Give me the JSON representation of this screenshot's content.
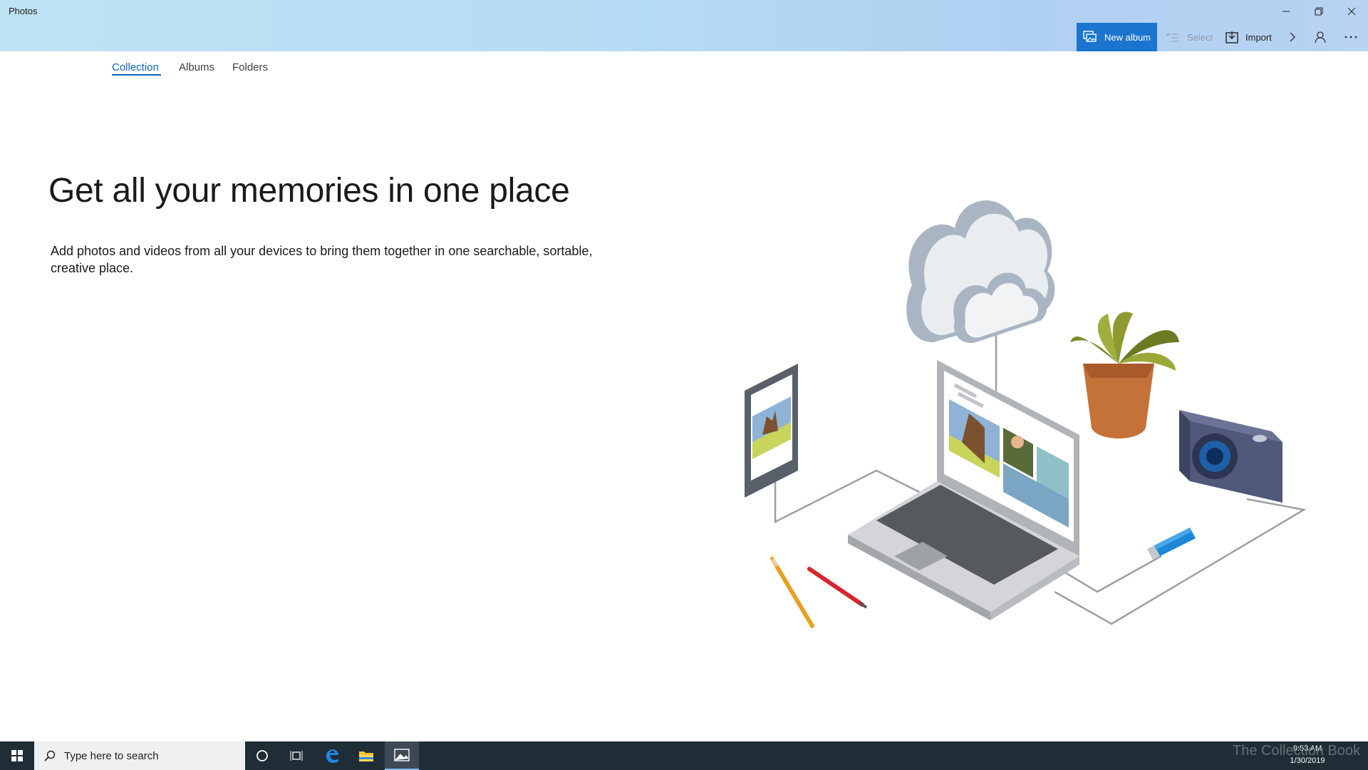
{
  "window": {
    "title": "Photos"
  },
  "commandbar": {
    "new_album_label": "New album",
    "select_label": "Select",
    "import_label": "Import"
  },
  "tabs": [
    {
      "label": "Collection",
      "active": true
    },
    {
      "label": "Albums",
      "active": false
    },
    {
      "label": "Folders",
      "active": false
    }
  ],
  "hero": {
    "headline": "Get all your memories in one place",
    "subtext": "Add photos and videos from all your devices to bring them together in one searchable, sortable, creative place."
  },
  "taskbar": {
    "search_placeholder": "Type here to search",
    "clock_time": "9:53 AM",
    "clock_date": "1/30/2019",
    "watermark": "The Collection Book"
  },
  "colors": {
    "accent": "#1b74d0",
    "tab_active": "#0b63c5",
    "taskbar": "#1f2d36"
  },
  "icons": [
    "minimize-icon",
    "restore-icon",
    "close-icon",
    "new-album-icon",
    "select-icon",
    "import-icon",
    "chevron-right-icon",
    "account-icon",
    "more-icon",
    "windows-start-icon",
    "search-icon",
    "cortana-icon",
    "task-view-icon",
    "edge-icon",
    "file-explorer-icon",
    "photos-icon"
  ]
}
